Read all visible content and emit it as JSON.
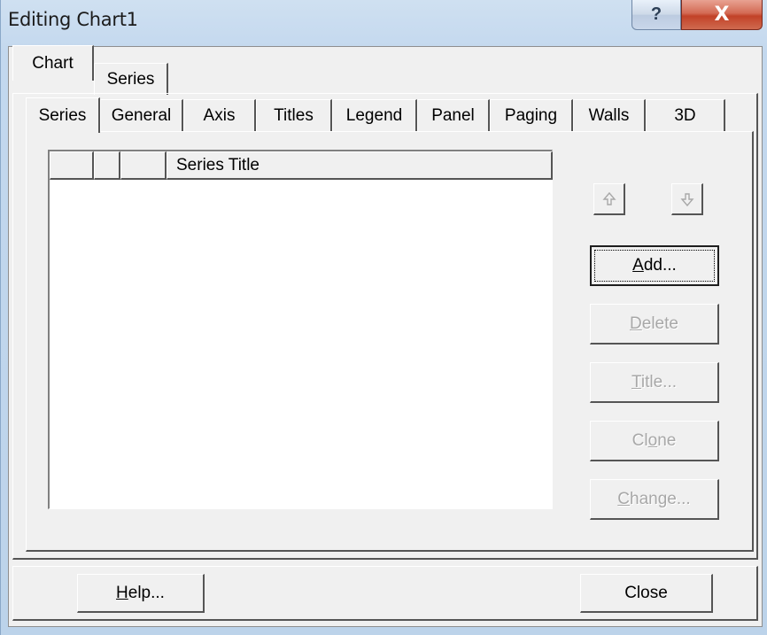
{
  "window": {
    "title": "Editing Chart1",
    "help_glyph": "?",
    "close_glyph": "X"
  },
  "outer_tabs": [
    {
      "label": "Chart",
      "active": true
    },
    {
      "label": "Series",
      "active": false
    }
  ],
  "inner_tabs": [
    {
      "label": "Series",
      "active": true
    },
    {
      "label": "General",
      "active": false
    },
    {
      "label": "Axis",
      "active": false
    },
    {
      "label": "Titles",
      "active": false
    },
    {
      "label": "Legend",
      "active": false
    },
    {
      "label": "Panel",
      "active": false
    },
    {
      "label": "Paging",
      "active": false
    },
    {
      "label": "Walls",
      "active": false
    },
    {
      "label": "3D",
      "active": false
    }
  ],
  "series_list": {
    "column_title": "Series Title",
    "rows": []
  },
  "buttons": {
    "move_up_icon": "arrow-up-icon",
    "move_down_icon": "arrow-down-icon",
    "add": {
      "pre": "",
      "ul": "A",
      "post": "dd..."
    },
    "delete": {
      "pre": "",
      "ul": "D",
      "post": "elete"
    },
    "title": {
      "pre": "",
      "ul": "T",
      "post": "itle..."
    },
    "clone": {
      "pre": "Cl",
      "ul": "o",
      "post": "ne"
    },
    "change": {
      "pre": "",
      "ul": "C",
      "post": "hange..."
    },
    "help": {
      "pre": "",
      "ul": "H",
      "post": "elp..."
    },
    "close": "Close"
  },
  "colors": {
    "face": "#f0f0f0",
    "disabled_text": "#a8a8a8",
    "titlebar": "#c3d8ee",
    "close_red": "#c24228"
  }
}
